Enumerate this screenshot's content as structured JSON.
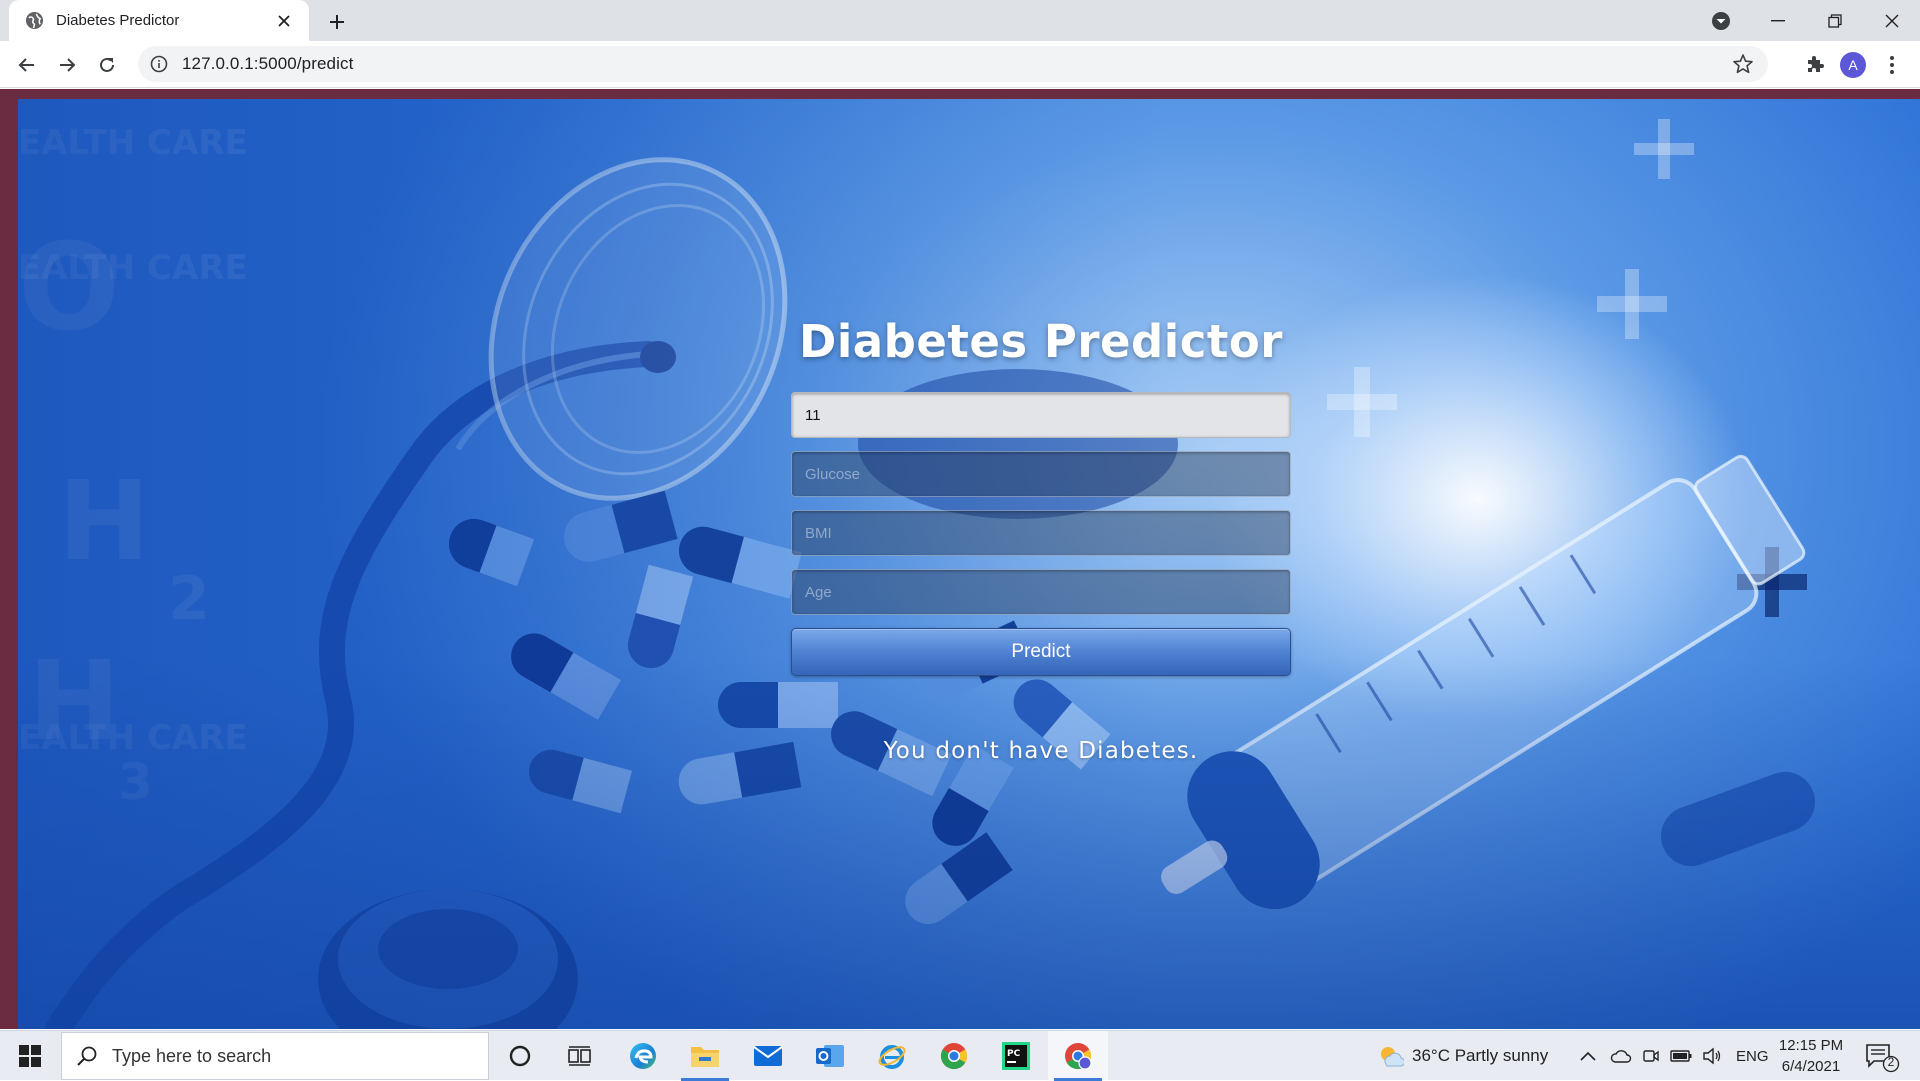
{
  "browser": {
    "tab_title": "Diabetes Predictor",
    "url": "127.0.0.1:5000/predict",
    "profile_initial": "A"
  },
  "page": {
    "title": "Diabetes Predictor",
    "fields": [
      {
        "name": "pregnancies",
        "value": "11",
        "placeholder": ""
      },
      {
        "name": "glucose",
        "value": "",
        "placeholder": "Glucose"
      },
      {
        "name": "bmi",
        "value": "",
        "placeholder": "BMI"
      },
      {
        "name": "age",
        "value": "",
        "placeholder": "Age"
      }
    ],
    "predict_label": "Predict",
    "result_text": "You don't have Diabetes."
  },
  "taskbar": {
    "search_placeholder": "Type here to search",
    "apps": [
      "cortana-icon",
      "task-view-icon",
      "edge-icon",
      "file-explorer-icon",
      "mail-icon",
      "outlook-icon",
      "internet-explorer-icon",
      "chrome-icon",
      "pycharm-icon",
      "chrome-profile-icon"
    ],
    "weather": "36°C  Partly sunny",
    "language": "ENG",
    "time": "12:15 PM",
    "date": "6/4/2021",
    "notification_count": "2"
  },
  "colors": {
    "accent": "#3d7bd6",
    "hero_blue": "#2a6fd6",
    "predict_button": "#4f82d2"
  }
}
